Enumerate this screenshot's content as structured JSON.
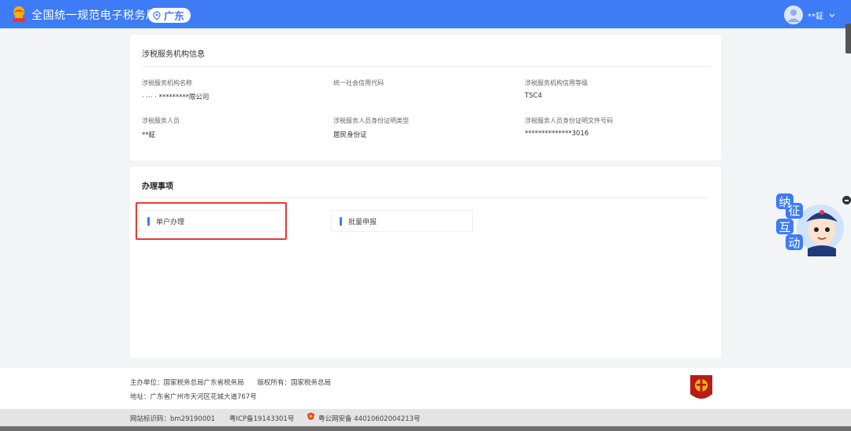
{
  "header": {
    "site_title": "全国统一规范电子税务局",
    "region": "广东",
    "user_name": "**鉦"
  },
  "org_card": {
    "title": "涉税服务机构信息",
    "fields": [
      {
        "label": "涉税服务机构名称",
        "value": "· ··· · *********限公司"
      },
      {
        "label": "统一社会信用代码",
        "value": ""
      },
      {
        "label": "涉税服务机构信用等级",
        "value": "TSC4"
      },
      {
        "label": "涉税服务人员",
        "value": "**鉦"
      },
      {
        "label": "涉税服务人员身份证明类型",
        "value": "居民身份证"
      },
      {
        "label": "涉税服务人员身份证明文件号码",
        "value": "**************3016"
      }
    ]
  },
  "tasks_card": {
    "title": "办理事项",
    "items": [
      {
        "label": "单户办理"
      },
      {
        "label": "批量申报"
      }
    ]
  },
  "mascot": {
    "chars": [
      "征",
      "纳",
      "互",
      "动"
    ]
  },
  "footer": {
    "line1": "主办单位：国家税务总局广东省税务局　　版权所有：国家税务总局",
    "line2": "地址：广东省广州市天河区花城大道767号",
    "site_id": "网站标识码：bm29190001",
    "icp": "粤ICP备19143301号",
    "police": "粤公网安备 44010602004213号"
  },
  "colors": {
    "brand_blue": "#3e7bf6",
    "highlight_red": "#e53935"
  }
}
